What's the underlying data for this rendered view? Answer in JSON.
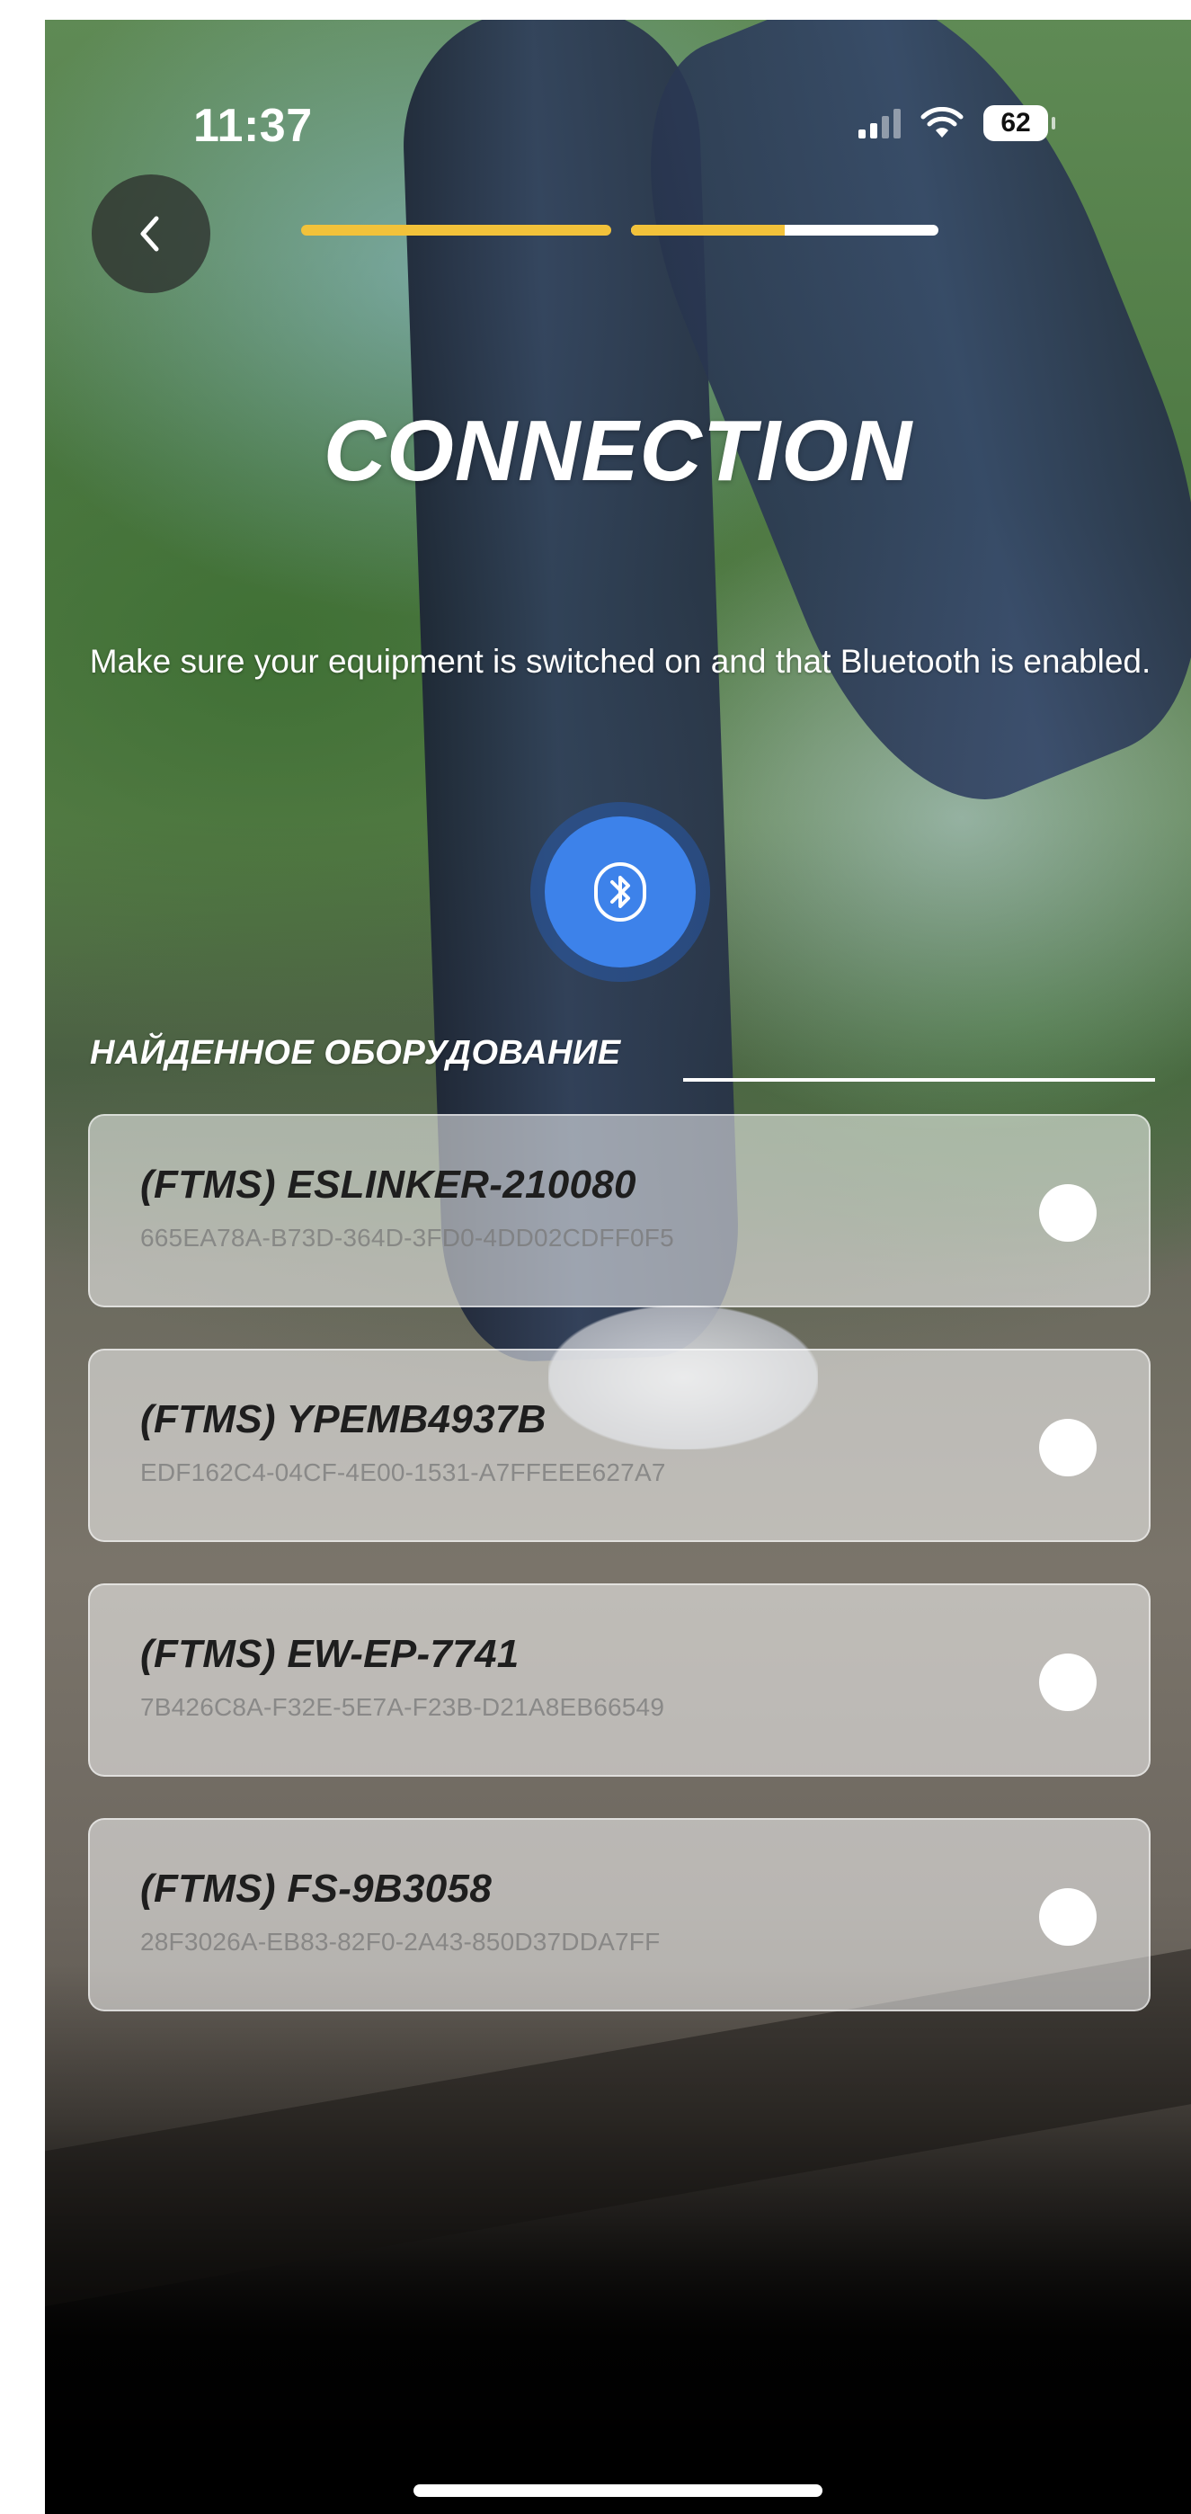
{
  "status_bar": {
    "time": "11:37",
    "battery": "62"
  },
  "header": {
    "back_icon": "chevron-left-icon",
    "progress_steps": [
      {
        "fill_fraction": 1.0,
        "color": "#f2c23a"
      },
      {
        "fill_fraction": 0.5,
        "color": "#f2c23a"
      }
    ]
  },
  "title": "CONNECTION",
  "subtitle": "Make sure your equipment is switched on and that Bluetooth is enabled.",
  "bluetooth_icon": "bluetooth-icon",
  "section_label": "НАЙДЕННОЕ ОБОРУДОВАНИЕ",
  "devices": [
    {
      "name": "(FTMS) ESLINKER-210080",
      "uuid": "665EA78A-B73D-364D-3FD0-4DD02CDFF0F5"
    },
    {
      "name": "(FTMS) YPEMB4937B",
      "uuid": "EDF162C4-04CF-4E00-1531-A7FFEEE627A7"
    },
    {
      "name": "(FTMS) EW-EP-7741",
      "uuid": "7B426C8A-F32E-5E7A-F23B-D21A8EB66549"
    },
    {
      "name": "(FTMS) FS-9B3058",
      "uuid": "28F3026A-EB83-82F0-2A43-850D37DDA7FF"
    }
  ],
  "colors": {
    "accent": "#f2c23a",
    "bluetooth": "#3d82ea"
  }
}
